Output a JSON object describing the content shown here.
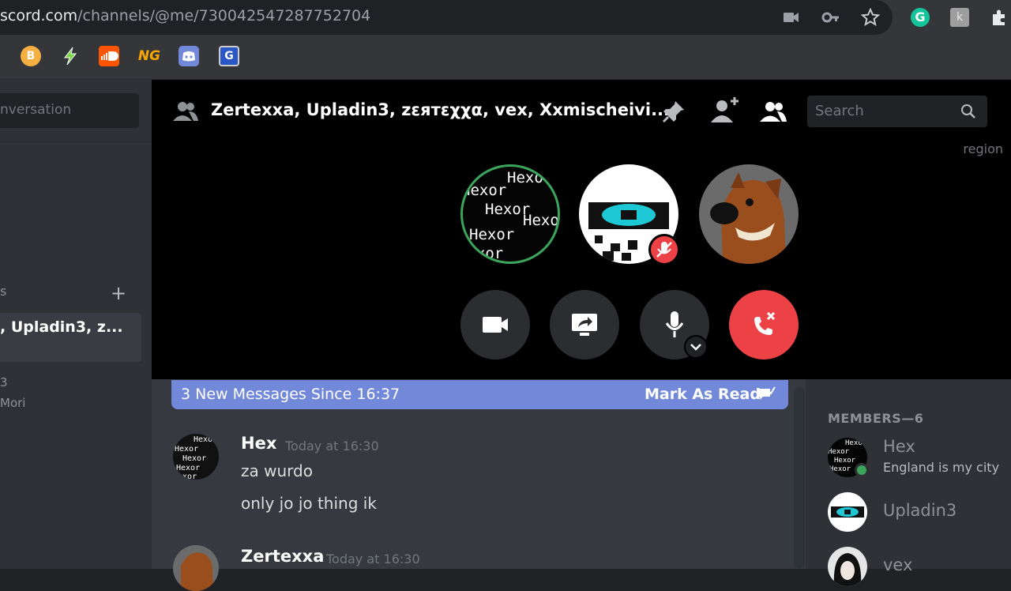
{
  "browser": {
    "url_host": "scord.com",
    "url_path": "/channels/@me/730042547287752704"
  },
  "sidebar": {
    "search_placeholder": "nversation",
    "active_dm_label": ", Upladin3, z...",
    "small_label_1": "3",
    "small_label_2": "Mori"
  },
  "header": {
    "title": "Zertexxa, Upladin3, zεятεχχα, vex, Xxmischeivi...",
    "search_placeholder": "Search",
    "region_label": "region"
  },
  "banner": {
    "text": "3 New Messages Since 16:37",
    "mark_read": "Mark As Read"
  },
  "messages": [
    {
      "author": "Hex",
      "time": "Today at 16:30",
      "lines": [
        "za wurdo",
        "only jo jo thing ik"
      ]
    },
    {
      "author": "Zertexxa",
      "time": "Today at 16:30",
      "lines": []
    }
  ],
  "members": {
    "title": "MEMBERS—6",
    "list": [
      {
        "name": "Hex",
        "status": "England is my city"
      },
      {
        "name": "Upladin3",
        "status": ""
      },
      {
        "name": "vex",
        "status": ""
      }
    ]
  },
  "avatar_text": "Hexor",
  "colors": {
    "accent": "#7289da",
    "end_call": "#ed4245",
    "speaking_ring": "#3ba55c",
    "grammarly": "#15c39a"
  }
}
